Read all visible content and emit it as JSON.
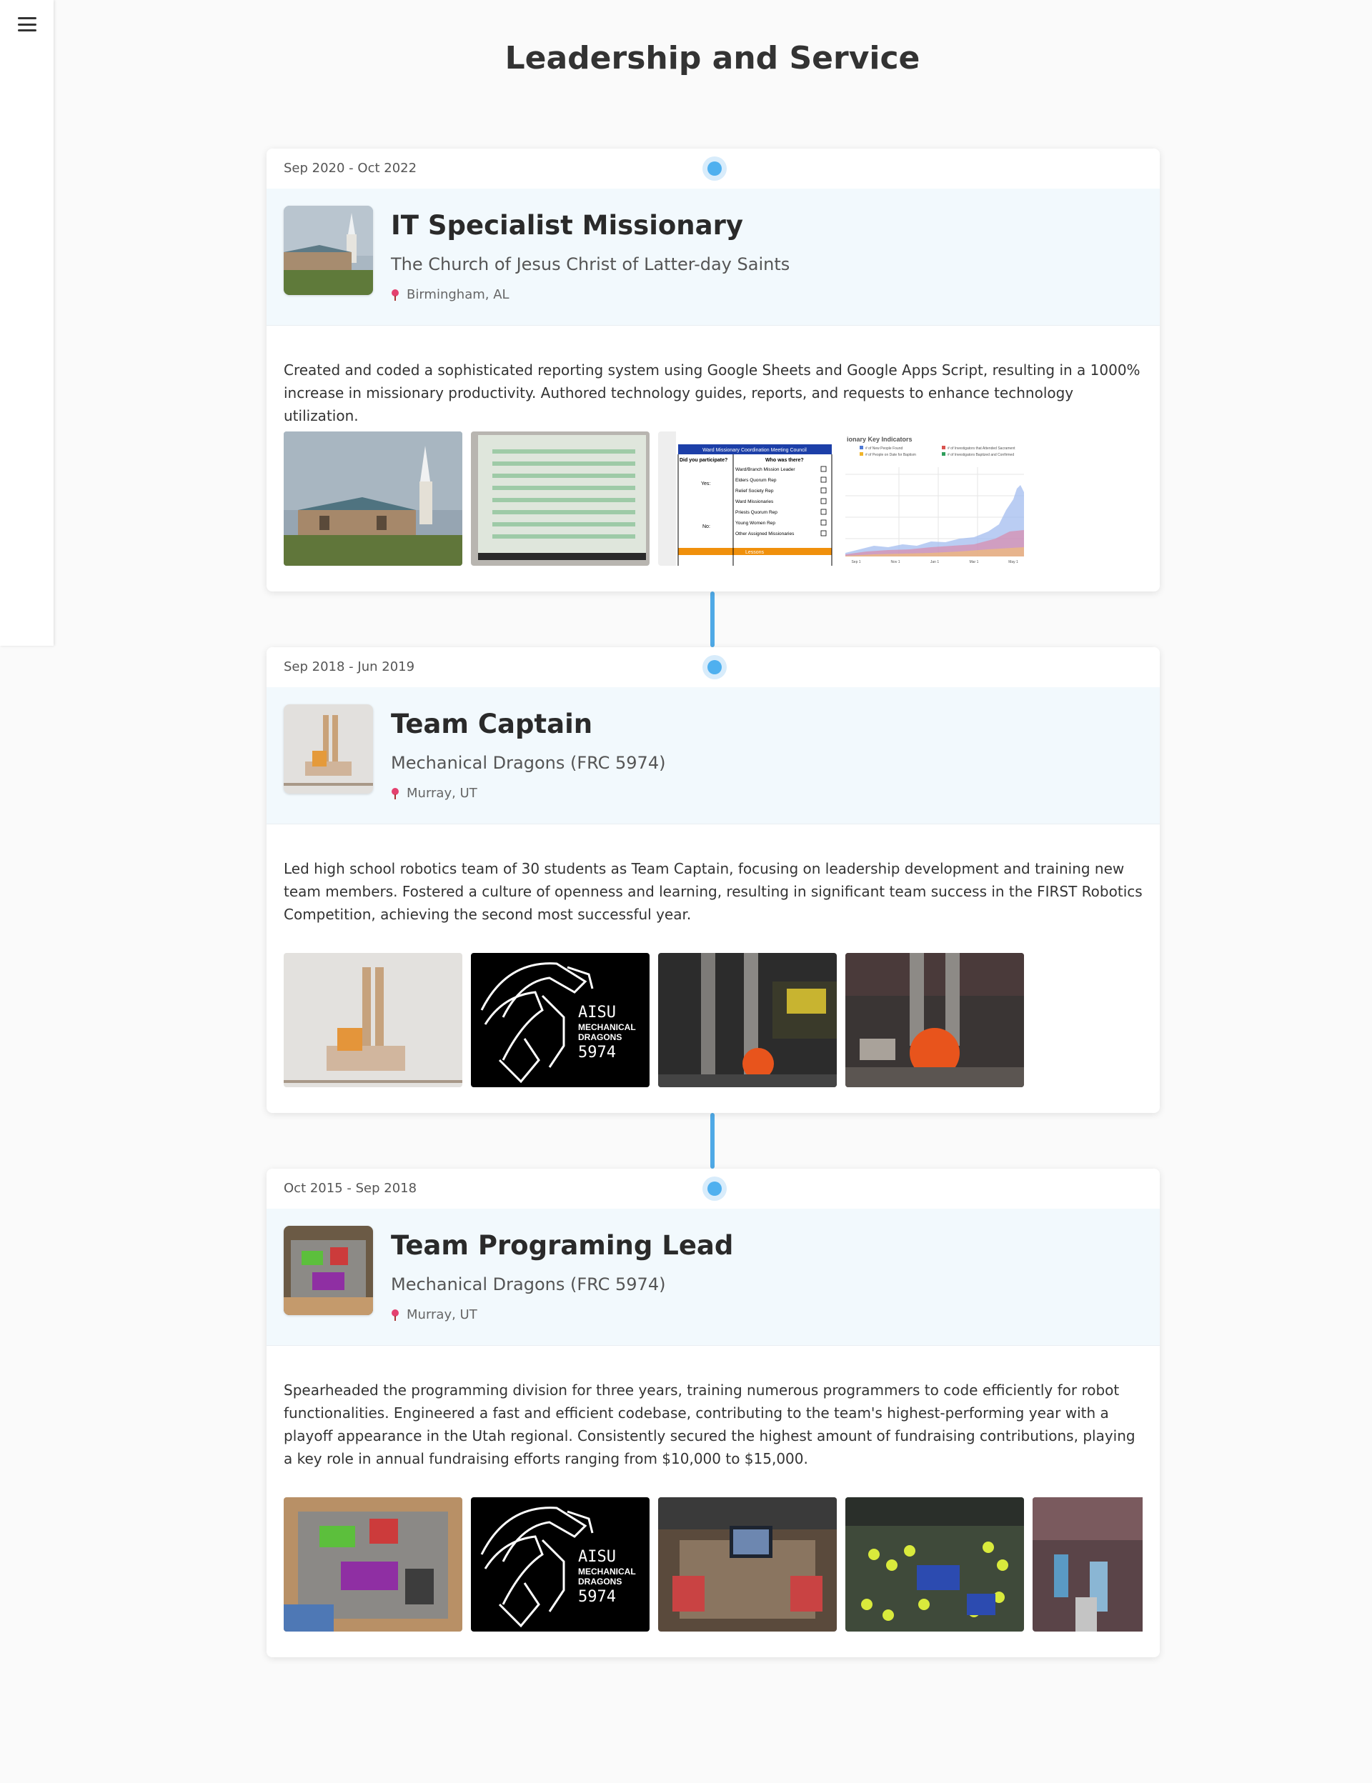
{
  "page": {
    "title": "Leadership and Service"
  },
  "sidebar": {
    "menu_icon": "hamburger-menu-icon"
  },
  "accent_color": "#4fa9e6",
  "experiences": [
    {
      "date": "Sep 2020 - Oct 2022",
      "role": "IT Specialist Missionary",
      "org": "The Church of Jesus Christ of Latter-day Saints",
      "location": "Birmingham, AL",
      "description": "Created and coded a sophisticated reporting system using Google Sheets and Google Apps Script, resulting in a 1000% increase in missionary productivity. Authored technology guides, reports, and requests to enhance technology utilization.",
      "images": [
        "church-building-photo",
        "spreadsheet-screen-photo",
        "meeting-council-checklist",
        "key-indicators-chart"
      ],
      "image_text": {
        "checklist_title": "Ward Missionary Coordination Meeting Council",
        "checklist_q": "Did you participate?",
        "checklist_q2": "Who was there?",
        "checklist_yes": "Yes:",
        "checklist_no": "No:",
        "checklist_items": [
          "Ward/Branch Mission Leader",
          "Elders Quorum Rep",
          "Relief Society Rep",
          "Ward Missionaries",
          "Priests Quorum Rep",
          "Young Women Rep",
          "Other Assigned Missionaries"
        ],
        "checklist_footer": "Lessons",
        "chart_title": "ionary Key Indicators",
        "chart_legend": [
          "# of New People Found",
          "# of Investigators that Attended Sacrament",
          "# of People on Date for Baptism",
          "# of Investigators Baptized and Confirmed"
        ],
        "chart_ticks": [
          "Sep 1",
          "Nov 1",
          "Jan 1",
          "Mar 1",
          "May 1"
        ]
      }
    },
    {
      "date": "Sep 2018 - Jun 2019",
      "role": "Team Captain",
      "org": "Mechanical Dragons (FRC 5974)",
      "location": "Murray, UT",
      "description": "Led high school robotics team of 30 students as Team Captain, focusing on leadership development and training new team members. Fostered a culture of openness and learning, resulting in significant team success in the FIRST Robotics Competition, achieving the second most successful year.",
      "images": [
        "robot-cad-model",
        "mechanical-dragons-logo",
        "robot-intake-photo",
        "robot-ball-photo"
      ],
      "logo_text": {
        "line1": "AISU",
        "line2": "MECHANICAL",
        "line3": "DRAGONS",
        "line4": "5974"
      }
    },
    {
      "date": "Oct 2015 - Sep 2018",
      "role": "Team Programing Lead",
      "org": "Mechanical Dragons (FRC 5974)",
      "location": "Murray, UT",
      "description": "Spearheaded the programming division for three years, training numerous programmers to code efficiently for robot functionalities. Engineered a fast and efficient codebase, contributing to the team's highest-performing year with a playoff appearance in the Utah regional. Consistently secured the highest amount of fundraising contributions, playing a key role in annual fundraising efforts ranging from $10,000 to $15,000.",
      "images": [
        "robot-chassis-photo",
        "mechanical-dragons-logo",
        "pit-laptop-photo",
        "competition-field-photo",
        "arena-crowd-photo"
      ],
      "logo_text": {
        "line1": "AISU",
        "line2": "MECHANICAL",
        "line3": "DRAGONS",
        "line4": "5974"
      }
    }
  ]
}
